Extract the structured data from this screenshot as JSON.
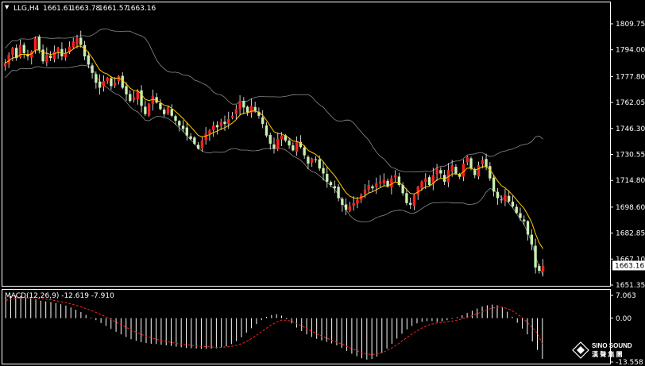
{
  "colors": {
    "background": "#000000",
    "frame": "#ffffff",
    "bull_candle": "#ff2020",
    "bear_candle": "#c8f0b0",
    "wick": "#ffffff",
    "bollinger": "#8a8a8a",
    "moving_average": "#ffcc00",
    "macd_hist": "#ffffff",
    "macd_signal": "#ff2020",
    "price_tag_bg": "#ffffff"
  },
  "header": {
    "arrow_icon": "triangle-down-icon",
    "label": "LLG,H4",
    "open": "1661.61",
    "high": "1663.78",
    "low": "1661.57",
    "close": "1663.16"
  },
  "price_axis": {
    "ticks": [
      "1809.75",
      "1794.00",
      "1777.80",
      "1762.05",
      "1746.30",
      "1730.55",
      "1714.80",
      "1698.60",
      "1682.85",
      "1667.10",
      "1651.35"
    ],
    "current_price_label": "1663.16"
  },
  "macd": {
    "label": "MACD(12,26,9) -12.619 -7.910",
    "ticks": [
      "7.063",
      "0.00",
      "-13.558"
    ]
  },
  "logo": {
    "name": "SINO SOUND",
    "subtitle": "漢 聲 集 團"
  },
  "chart_data": {
    "type": "candlestick",
    "symbol": "LLG",
    "timeframe": "H4",
    "price_axis_range": [
      1651.35,
      1809.75
    ],
    "macd_axis_range": [
      -13.558,
      7.063
    ],
    "overlays": [
      "bollinger_bands",
      "moving_average"
    ],
    "close_series": [
      1786,
      1791,
      1795,
      1789,
      1797,
      1792,
      1790,
      1793,
      1801,
      1794,
      1787,
      1791,
      1789,
      1793,
      1795,
      1790,
      1792,
      1796,
      1799,
      1801,
      1797,
      1790,
      1785,
      1780,
      1774,
      1771,
      1775,
      1777,
      1772,
      1774,
      1778,
      1771,
      1767,
      1763,
      1765,
      1769,
      1760,
      1755,
      1761,
      1766,
      1762,
      1758,
      1755,
      1759,
      1754,
      1751,
      1748,
      1746,
      1742,
      1740,
      1737,
      1734,
      1739,
      1743,
      1745,
      1748,
      1747,
      1750,
      1749,
      1752,
      1754,
      1758,
      1763,
      1759,
      1756,
      1760,
      1757,
      1754,
      1749,
      1742,
      1737,
      1734,
      1740,
      1742,
      1739,
      1736,
      1733,
      1738,
      1735,
      1730,
      1725,
      1728,
      1727,
      1722,
      1719,
      1714,
      1712,
      1710,
      1704,
      1700,
      1697,
      1699,
      1701,
      1703,
      1706,
      1709,
      1712,
      1710,
      1713,
      1714,
      1715,
      1711,
      1716,
      1718,
      1712,
      1707,
      1701,
      1700,
      1706,
      1711,
      1714,
      1716,
      1712,
      1718,
      1722,
      1719,
      1714,
      1721,
      1724,
      1719,
      1717,
      1725,
      1729,
      1722,
      1718,
      1724,
      1727,
      1723,
      1716,
      1708,
      1704,
      1703,
      1706,
      1702,
      1699,
      1695,
      1692,
      1690,
      1682,
      1676,
      1662,
      1660,
      1663
    ],
    "macd_histogram": [
      6.5,
      6.8,
      7.0,
      6.9,
      6.6,
      6.2,
      5.8,
      5.4,
      5.2,
      5.0,
      4.7,
      4.3,
      3.9,
      3.3,
      2.6,
      1.9,
      1.0,
      0.2,
      -0.6,
      -1.5,
      -2.4,
      -3.3,
      -4.2,
      -5.0,
      -5.8,
      -6.5,
      -7.0,
      -7.4,
      -7.7,
      -7.9,
      -8.0,
      -8.2,
      -8.4,
      -8.6,
      -8.8,
      -9.0,
      -9.2,
      -9.3,
      -9.4,
      -9.5,
      -9.5,
      -9.4,
      -9.3,
      -9.1,
      -8.7,
      -8.0,
      -7.1,
      -5.9,
      -4.5,
      -3.1,
      -1.8,
      -0.6,
      0.4,
      1.0,
      1.2,
      0.8,
      -0.3,
      -1.6,
      -2.9,
      -4.0,
      -5.0,
      -5.8,
      -6.4,
      -6.9,
      -7.3,
      -7.8,
      -8.4,
      -9.2,
      -10.1,
      -11.0,
      -11.8,
      -12.4,
      -12.8,
      -12.6,
      -11.9,
      -10.8,
      -9.4,
      -7.9,
      -6.3,
      -4.8,
      -3.5,
      -2.4,
      -1.6,
      -1.1,
      -0.9,
      -0.9,
      -1.2,
      -1.0,
      -0.6,
      -0.2,
      0.3,
      0.9,
      1.6,
      2.3,
      3.0,
      3.6,
      4.0,
      4.2,
      4.0,
      3.3,
      2.0,
      0.4,
      -1.4,
      -3.2,
      -5.0,
      -7.2,
      -9.8,
      -12.6
    ],
    "macd_signal": [
      5.5,
      5.8,
      6.1,
      6.3,
      6.4,
      6.4,
      6.3,
      6.1,
      5.9,
      5.7,
      5.4,
      5.1,
      4.8,
      4.4,
      4.0,
      3.5,
      3.0,
      2.4,
      1.8,
      1.1,
      0.4,
      -0.4,
      -1.2,
      -2.0,
      -2.8,
      -3.6,
      -4.3,
      -5.0,
      -5.6,
      -6.1,
      -6.5,
      -6.9,
      -7.2,
      -7.5,
      -7.8,
      -8.0,
      -8.2,
      -8.4,
      -8.6,
      -8.7,
      -8.8,
      -8.9,
      -9.0,
      -9.0,
      -8.9,
      -8.7,
      -8.4,
      -7.9,
      -7.2,
      -6.3,
      -5.3,
      -4.2,
      -3.1,
      -2.1,
      -1.2,
      -0.6,
      -0.6,
      -1.0,
      -1.6,
      -2.4,
      -3.2,
      -4.0,
      -4.8,
      -5.5,
      -6.2,
      -6.8,
      -7.4,
      -8.0,
      -8.7,
      -9.4,
      -10.0,
      -10.6,
      -11.0,
      -11.2,
      -11.1,
      -10.7,
      -10.0,
      -9.2,
      -8.2,
      -7.1,
      -6.0,
      -4.9,
      -3.9,
      -3.0,
      -2.3,
      -1.8,
      -1.5,
      -1.3,
      -1.1,
      -0.9,
      -0.6,
      -0.2,
      0.3,
      0.8,
      1.4,
      2.0,
      2.6,
      3.1,
      3.4,
      3.4,
      3.0,
      2.3,
      1.3,
      0.1,
      -1.3,
      -2.9,
      -4.7,
      -7.9
    ]
  }
}
